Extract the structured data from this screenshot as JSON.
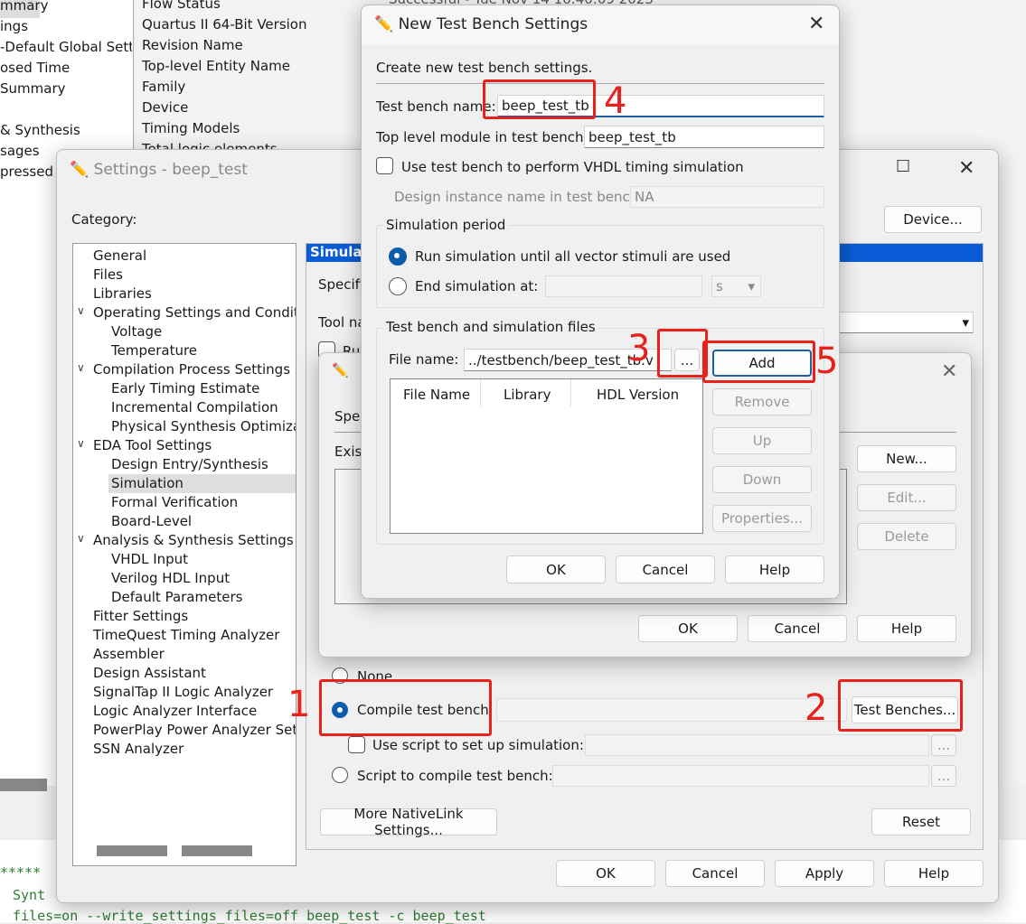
{
  "background": {
    "left_tree": [
      "mmary",
      "ings",
      "-Default Global Setti",
      "osed Time",
      "Summary",
      "",
      "& Synthesis",
      "sages",
      "pressed M"
    ],
    "summary_rows": [
      "Flow Status",
      "Quartus II 64-Bit Version",
      "Revision Name",
      "Top-level Entity Name",
      "Family",
      "Device",
      "Timing Models",
      "Total logic elements"
    ],
    "flow_status_value": "Successful - Tue Nov 14 16:40:09 2023",
    "console": [
      "*****",
      "Synt",
      "files=on --write_settings_files=off beep_test -c beep_test"
    ]
  },
  "settings": {
    "title": "Settings - beep_test",
    "category_label": "Category:",
    "device_button": "Device...",
    "categories": [
      {
        "label": "General",
        "level": 0
      },
      {
        "label": "Files",
        "level": 0
      },
      {
        "label": "Libraries",
        "level": 0
      },
      {
        "label": "Operating Settings and Conditic",
        "level": 0,
        "expanded": true
      },
      {
        "label": "Voltage",
        "level": 1
      },
      {
        "label": "Temperature",
        "level": 1
      },
      {
        "label": "Compilation Process Settings",
        "level": 0,
        "expanded": true
      },
      {
        "label": "Early Timing Estimate",
        "level": 1
      },
      {
        "label": "Incremental Compilation",
        "level": 1
      },
      {
        "label": "Physical Synthesis Optimizati",
        "level": 1
      },
      {
        "label": "EDA Tool Settings",
        "level": 0,
        "expanded": true
      },
      {
        "label": "Design Entry/Synthesis",
        "level": 1
      },
      {
        "label": "Simulation",
        "level": 1,
        "selected": true
      },
      {
        "label": "Formal Verification",
        "level": 1
      },
      {
        "label": "Board-Level",
        "level": 1
      },
      {
        "label": "Analysis & Synthesis Settings",
        "level": 0,
        "expanded": true
      },
      {
        "label": "VHDL Input",
        "level": 1
      },
      {
        "label": "Verilog HDL Input",
        "level": 1
      },
      {
        "label": "Default Parameters",
        "level": 1
      },
      {
        "label": "Fitter Settings",
        "level": 0
      },
      {
        "label": "TimeQuest Timing Analyzer",
        "level": 0
      },
      {
        "label": "Assembler",
        "level": 0
      },
      {
        "label": "Design Assistant",
        "level": 0
      },
      {
        "label": "SignalTap II Logic Analyzer",
        "level": 0
      },
      {
        "label": "Logic Analyzer Interface",
        "level": 0
      },
      {
        "label": "PowerPlay Power Analyzer Setti",
        "level": 0
      },
      {
        "label": "SSN Analyzer",
        "level": 0
      }
    ],
    "panel_header": "Simula",
    "specify": "Specify",
    "tool_name": "Tool na",
    "run": "Ru",
    "none_radio": "None",
    "compile_tb_radio": "Compile test bench:",
    "test_benches_button": "Test Benches...",
    "use_script": "Use script to set up simulation:",
    "script_compile_radio": "Script to compile test bench:",
    "browse": "...",
    "nativelink_button": "More NativeLink Settings...",
    "reset_button": "Reset",
    "ok": "OK",
    "cancel": "Cancel",
    "apply": "Apply",
    "help": "Help",
    "accent": "#0a5cd6"
  },
  "test_benches": {
    "spec": "Spec",
    "exist": "Exist",
    "new": "New...",
    "edit": "Edit...",
    "delete": "Delete",
    "ok": "OK",
    "cancel": "Cancel",
    "help": "Help"
  },
  "new_tb": {
    "title": "New Test Bench Settings",
    "intro": "Create new test bench settings.",
    "name_label": "Test bench name:",
    "name_value": "beep_test_tb",
    "top_label": "Top level module in test bench:",
    "top_value": "beep_test_tb",
    "vhdl_check": "Use test bench to perform VHDL timing simulation",
    "instance_label": "Design instance name in test bench:",
    "instance_value": "NA",
    "sim_period": "Simulation period",
    "run_all": "Run simulation until all vector stimuli are used",
    "end_at": "End simulation at:",
    "unit": "s",
    "files_group": "Test bench and simulation files",
    "file_label": "File name:",
    "file_value": "../testbench/beep_test_tb.v",
    "browse": "...",
    "columns": [
      "File Name",
      "Library",
      "HDL Version"
    ],
    "add": "Add",
    "remove": "Remove",
    "up": "Up",
    "down": "Down",
    "properties": "Properties...",
    "ok": "OK",
    "cancel": "Cancel",
    "help": "Help"
  },
  "annotations": [
    "1",
    "2",
    "3",
    "4",
    "5"
  ],
  "annotation_color": "#e8221b"
}
